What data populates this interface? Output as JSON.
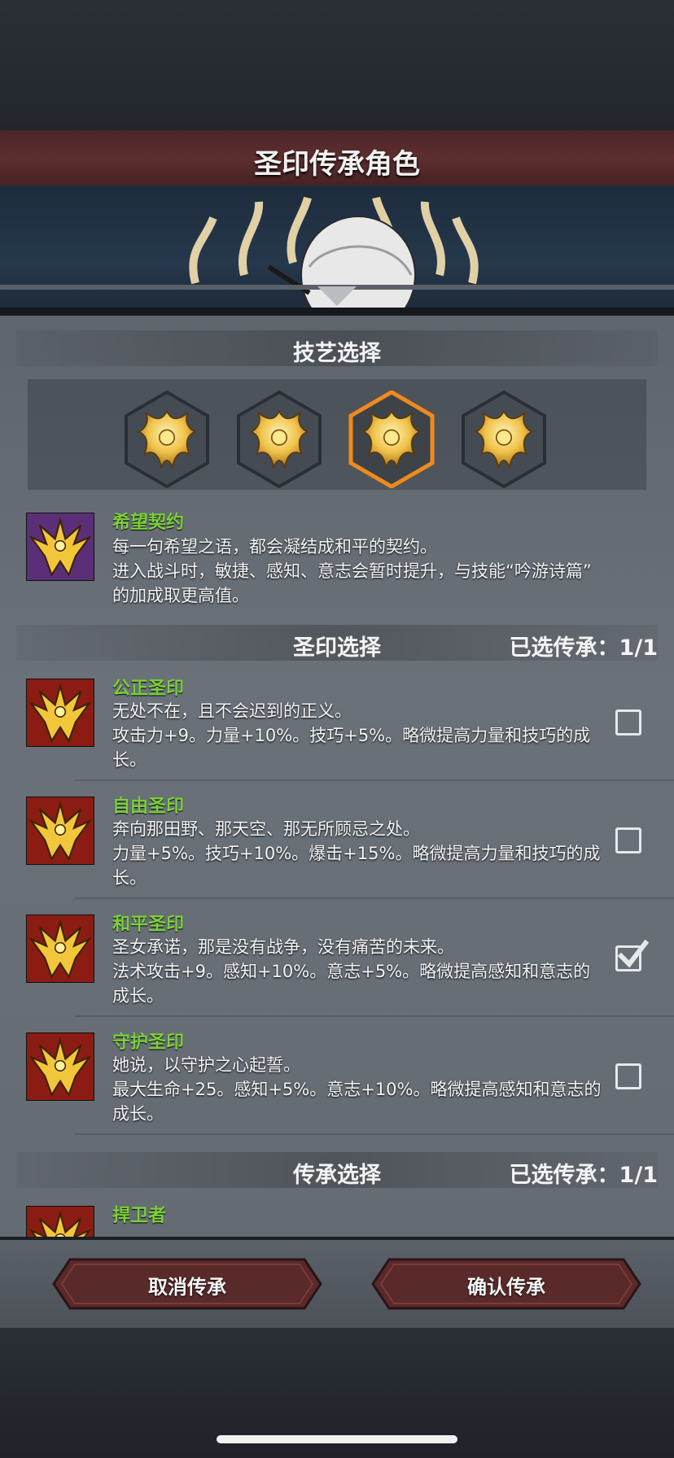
{
  "title": "圣印传承角色",
  "skill_section": {
    "label": "技艺选择",
    "icons": [
      "hope-pact-emblem-icon",
      "sigil-emblem-icon",
      "sigil-emblem-icon",
      "sigil-emblem-icon"
    ],
    "selected_index": 2
  },
  "skill_detail": {
    "name": "希望契约",
    "lines": [
      "每一句希望之语，都会凝结成和平的契约。",
      "进入战斗时，敏捷、感知、意志会暂时提升，与技能“吟游诗篇”",
      "的加成取更高值。"
    ]
  },
  "seal_section": {
    "label": "圣印选择",
    "count": "已选传承：1/1"
  },
  "seals": [
    {
      "name": "公正圣印",
      "lines": [
        "无处不在，且不会迟到的正义。",
        "攻击力+9。力量+10%。技巧+5%。略微提高力量和技巧的成",
        "长。"
      ],
      "checked": false
    },
    {
      "name": "自由圣印",
      "lines": [
        "奔向那田野、那天空、那无所顾忌之处。",
        "力量+5%。技巧+10%。爆击+15%。略微提高力量和技巧的成",
        "长。"
      ],
      "checked": false
    },
    {
      "name": "和平圣印",
      "lines": [
        "圣女承诺，那是没有战争，没有痛苦的未来。",
        "法术攻击+9。感知+10%。意志+5%。略微提高感知和意志的",
        "成长。"
      ],
      "checked": true
    },
    {
      "name": "守护圣印",
      "lines": [
        "她说，以守护之心起誓。",
        "最大生命+25。感知+5%。意志+10%。略微提高感知和意志的",
        "成长。"
      ],
      "checked": false
    }
  ],
  "inherit_section": {
    "label": "传承选择",
    "count": "已选传承：1/1"
  },
  "inherit_item": {
    "name": "捍卫者"
  },
  "buttons": {
    "cancel": "取消传承",
    "confirm": "确认传承"
  },
  "colors": {
    "accent_name": "#7bd03c",
    "selected_hex_border": "#f08a1c",
    "banner": "#5e2e2f"
  }
}
